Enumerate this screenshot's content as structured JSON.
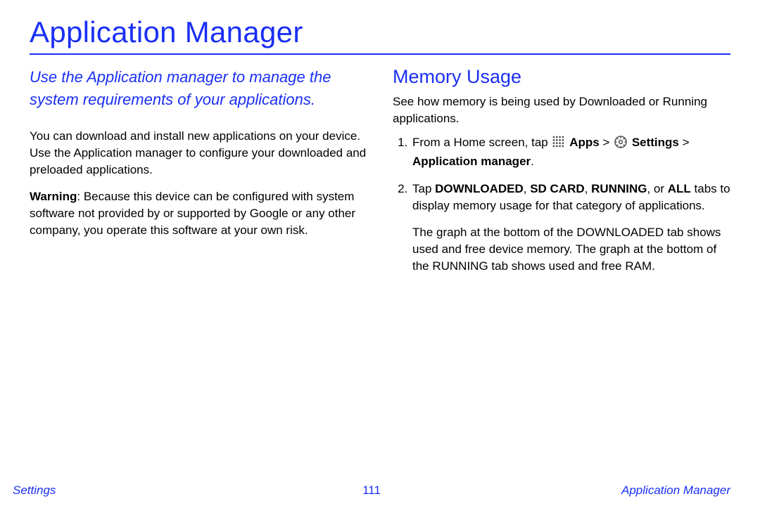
{
  "title": "Application Manager",
  "intro": "Use the Application manager to manage the system requirements of your applications.",
  "left": {
    "p1": "You can download and install new applications on your device. Use the Application manager to configure your downloaded and preloaded applications.",
    "warning_label": "Warning",
    "warning_text": ": Because this device can be configured with system software not provided by or supported by Google or any other company, you operate this software at your own risk."
  },
  "right": {
    "heading": "Memory Usage",
    "p1": "See how memory is being used by Downloaded or Running applications.",
    "step1_a": "From a Home screen, tap ",
    "step1_apps": "Apps",
    "step1_gt1": " > ",
    "step1_settings": "Settings",
    "step1_gt2": " > ",
    "step1_appmgr": "Application manager",
    "step1_end": ".",
    "step2_a": "Tap ",
    "step2_tabs": "DOWNLOADED",
    "step2_sep1": ", ",
    "step2_sd": "SD CARD",
    "step2_sep2": ", ",
    "step2_run": "RUNNING",
    "step2_sep3": ", or ",
    "step2_all": "ALL",
    "step2_b": " tabs to display memory usage for that category of applications.",
    "step2_note": "The graph at the bottom of the DOWNLOADED tab shows used and free device memory. The graph at the bottom of the RUNNING tab shows used and free RAM."
  },
  "footer": {
    "left": "Settings",
    "center": "111",
    "right": "Application Manager"
  }
}
